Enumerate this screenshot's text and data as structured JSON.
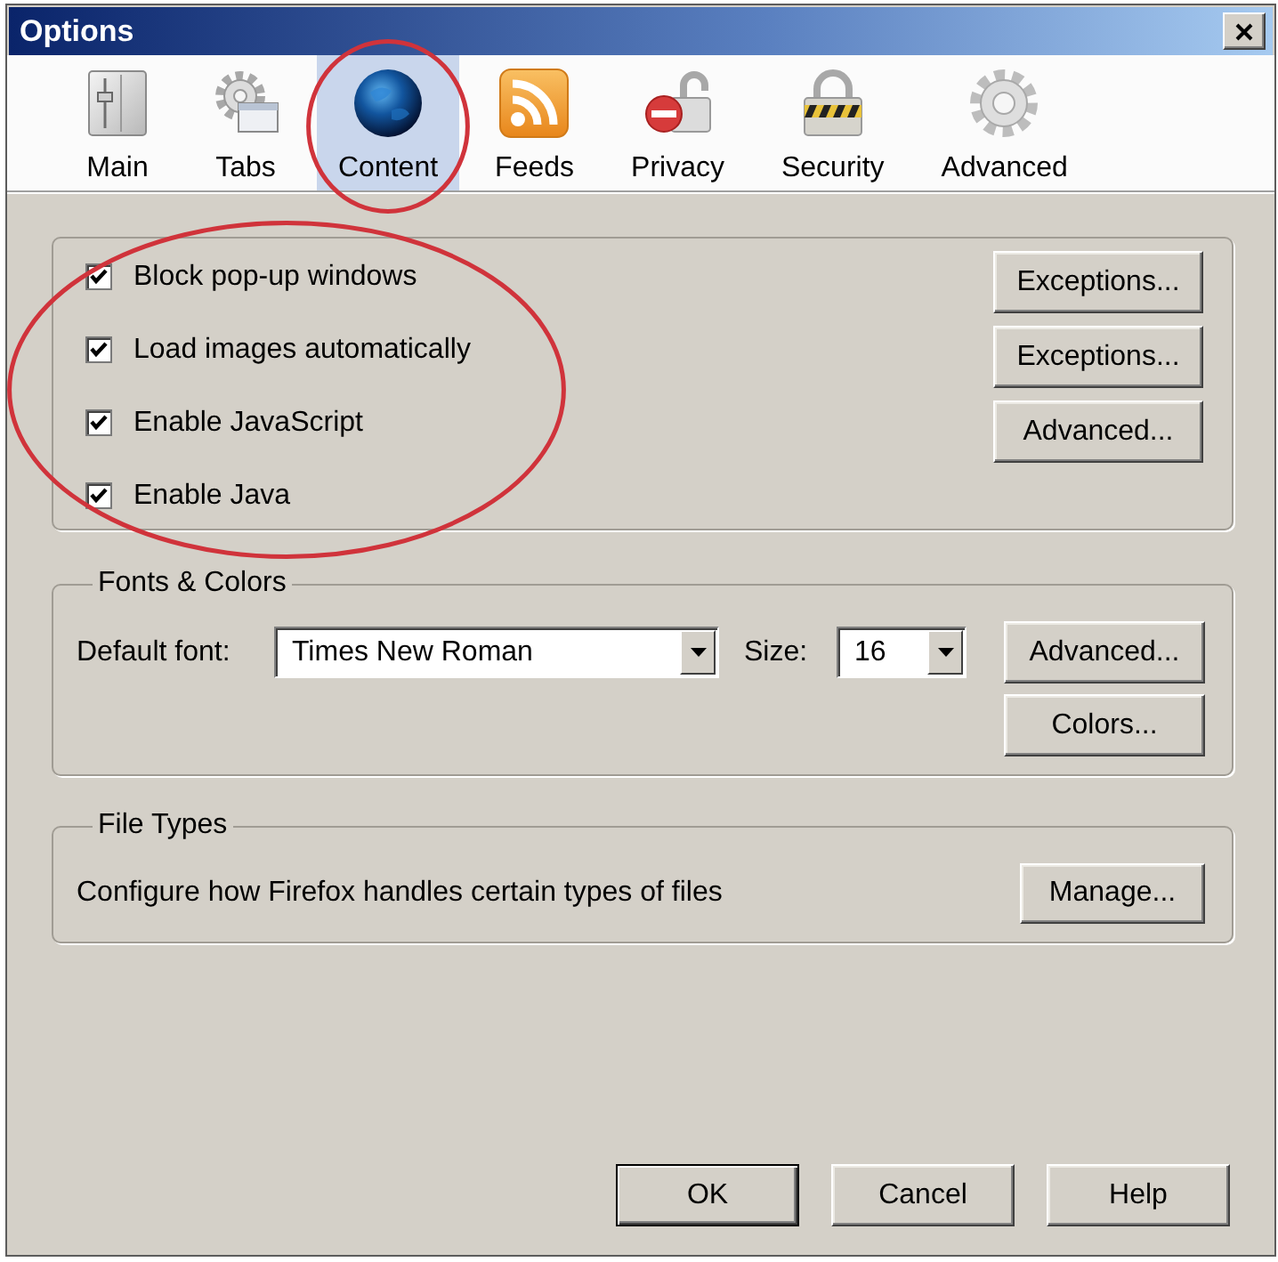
{
  "window": {
    "title": "Options"
  },
  "tabs": [
    {
      "label": "Main",
      "selected": false,
      "circled": false
    },
    {
      "label": "Tabs",
      "selected": false,
      "circled": false
    },
    {
      "label": "Content",
      "selected": true,
      "circled": true
    },
    {
      "label": "Feeds",
      "selected": false,
      "circled": false
    },
    {
      "label": "Privacy",
      "selected": false,
      "circled": false
    },
    {
      "label": "Security",
      "selected": false,
      "circled": false
    },
    {
      "label": "Advanced",
      "selected": false,
      "circled": false
    }
  ],
  "content_options": {
    "circled": true,
    "checkboxes": [
      {
        "label": "Block pop-up windows",
        "checked": true
      },
      {
        "label": "Load images automatically",
        "checked": true
      },
      {
        "label": "Enable JavaScript",
        "checked": true
      },
      {
        "label": "Enable Java",
        "checked": true
      }
    ],
    "buttons": [
      {
        "label": "Exceptions..."
      },
      {
        "label": "Exceptions..."
      },
      {
        "label": "Advanced..."
      }
    ]
  },
  "fonts_colors": {
    "title": "Fonts & Colors",
    "default_font": {
      "label": "Default font:",
      "value": "Times New Roman"
    },
    "size": {
      "label": "Size:",
      "value": "16"
    },
    "buttons": [
      {
        "label": "Advanced..."
      },
      {
        "label": "Colors..."
      }
    ]
  },
  "file_types": {
    "title": "File Types",
    "description": "Configure how Firefox handles certain types of files",
    "button": {
      "label": "Manage..."
    }
  },
  "dialog_buttons": [
    {
      "label": "OK",
      "default": true
    },
    {
      "label": "Cancel",
      "default": false
    },
    {
      "label": "Help",
      "default": false
    }
  ]
}
